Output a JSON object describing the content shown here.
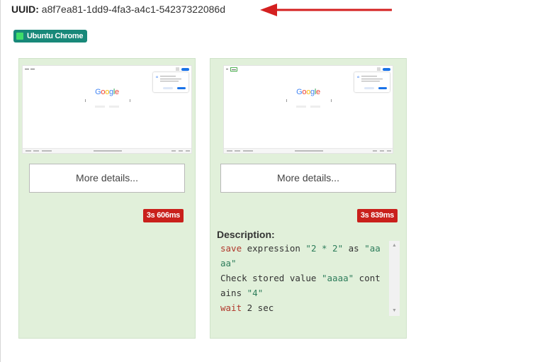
{
  "header": {
    "uuid_key": "UUID:",
    "uuid_value": "a8f7ea81-1dd9-4fa3-a4c1-54237322086d"
  },
  "environment_badge": {
    "label": "Ubuntu Chrome",
    "color": "#188879"
  },
  "results": [
    {
      "more_details_label": "More details...",
      "duration": "3s 606ms"
    },
    {
      "more_details_label": "More details...",
      "duration": "3s 839ms",
      "description_label": "Description:",
      "description_lines": [
        [
          {
            "t": "save",
            "c": "kw"
          },
          {
            "t": " expression ",
            "c": ""
          },
          {
            "t": "\"2 * 2\"",
            "c": "str"
          },
          {
            "t": " as ",
            "c": ""
          },
          {
            "t": "\"aa",
            "c": "str"
          }
        ],
        [
          {
            "t": "aa\"",
            "c": "str"
          }
        ],
        [
          {
            "t": "Check stored value ",
            "c": ""
          },
          {
            "t": "\"aaaa\"",
            "c": "str"
          },
          {
            "t": " cont",
            "c": ""
          }
        ],
        [
          {
            "t": "ains ",
            "c": ""
          },
          {
            "t": "\"4\"",
            "c": "str"
          }
        ],
        [
          {
            "t": "wait",
            "c": "kw"
          },
          {
            "t": " 2 sec",
            "c": ""
          }
        ]
      ]
    }
  ],
  "thumbnail": {
    "logo_text": "Google",
    "popup_icon": "G"
  },
  "colors": {
    "card_bg": "#e1f0da",
    "duration_badge": "#c9201b",
    "arrow": "#d42020",
    "keyword": "#b1372b",
    "string": "#2e7d5b"
  }
}
